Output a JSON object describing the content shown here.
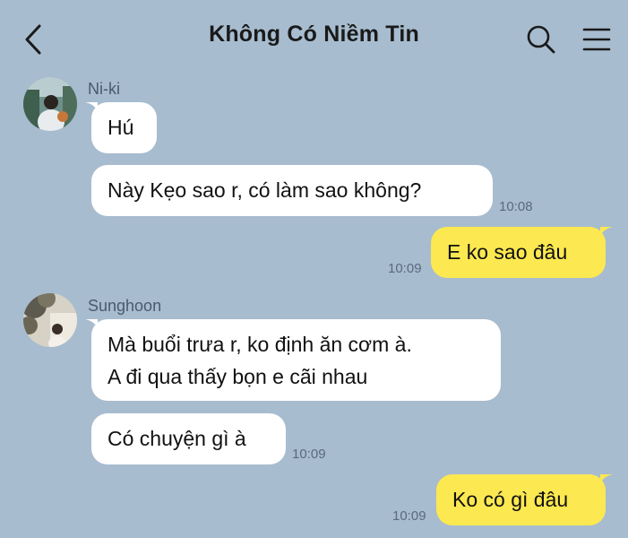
{
  "header": {
    "title": "Không Có Niềm Tin"
  },
  "messages": [
    {
      "sender": "Ni-ki",
      "text": "Hú"
    },
    {
      "text": "Này Kẹo sao r, có làm sao không?",
      "time": "10:08"
    },
    {
      "text": "E ko sao đâu",
      "time": "10:09"
    },
    {
      "sender": "Sunghoon",
      "line1": "Mà buổi trưa r, ko định ăn cơm à.",
      "line2": "A đi qua thấy bọn e cãi nhau"
    },
    {
      "text": "Có chuyện gì à",
      "time": "10:09"
    },
    {
      "text": "Ko có gì đâu",
      "time": "10:09"
    }
  ],
  "colors": {
    "background": "#a8bccf",
    "incoming": "#ffffff",
    "outgoing": "#fce850"
  },
  "icons": [
    "chevron-left-icon",
    "search-icon",
    "menu-icon"
  ]
}
